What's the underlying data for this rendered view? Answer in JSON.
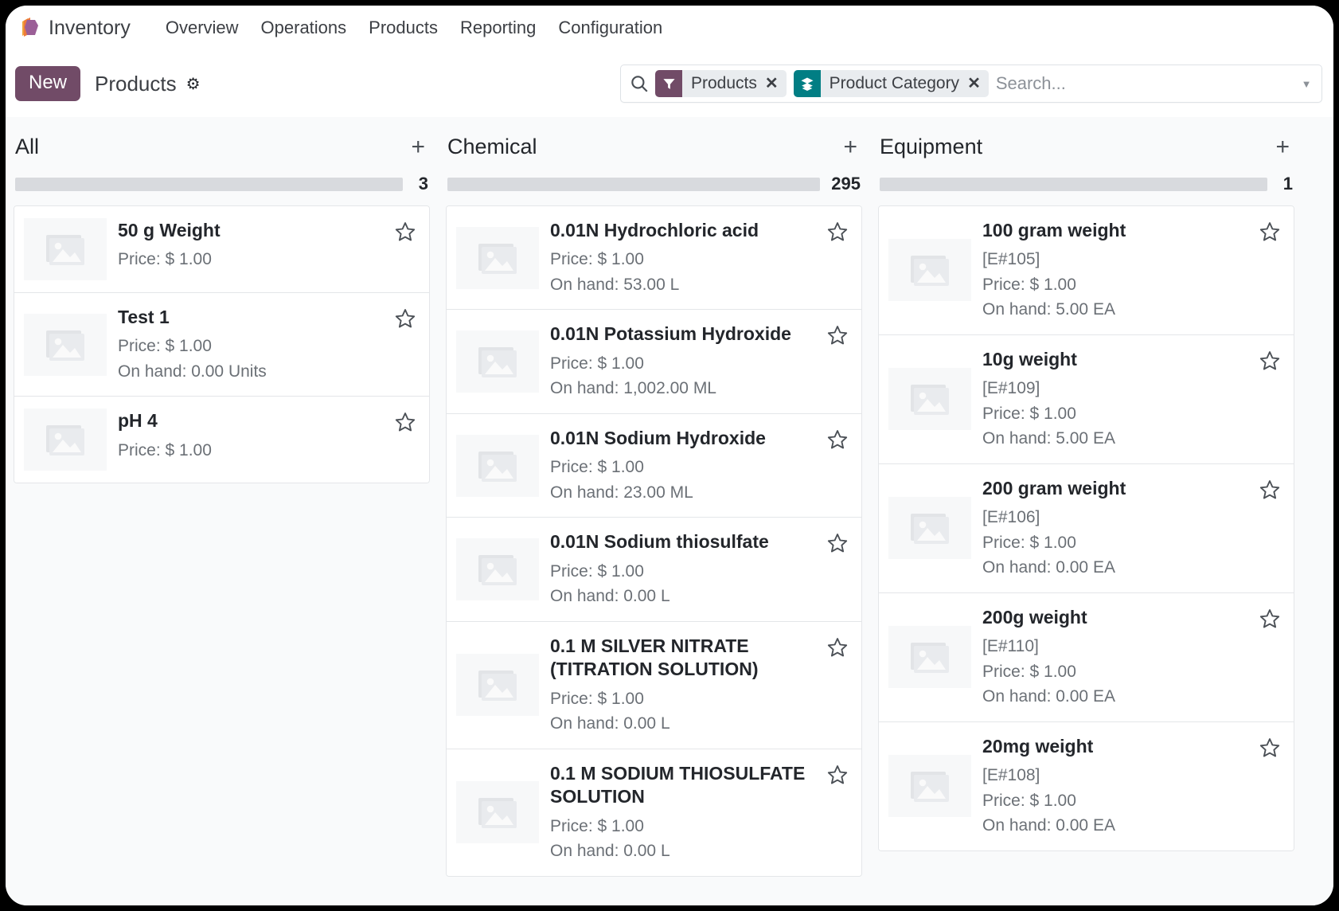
{
  "navbar": {
    "logo_icon": "inventory-box-icon",
    "app_name": "Inventory",
    "menu": [
      {
        "label": "Overview"
      },
      {
        "label": "Operations"
      },
      {
        "label": "Products"
      },
      {
        "label": "Reporting"
      },
      {
        "label": "Configuration"
      }
    ]
  },
  "control_panel": {
    "new_label": "New",
    "breadcrumb": "Products",
    "gear_icon": "gear-icon",
    "search": {
      "search_icon": "search-icon",
      "placeholder": "Search...",
      "value": "",
      "caret_icon": "chevron-down-icon",
      "facets": [
        {
          "label": "Products",
          "icon": "filter-icon",
          "color": "#714b67",
          "remove_icon": "close-icon"
        },
        {
          "label": "Product Category",
          "icon": "layers-icon",
          "color": "#017e84",
          "remove_icon": "close-icon"
        }
      ]
    }
  },
  "board": {
    "columns": [
      {
        "title": "All",
        "count": "3",
        "add_icon": "plus-icon",
        "cards": [
          {
            "title": "50 g Weight",
            "ref": "",
            "price": "Price: $ 1.00",
            "onhand": ""
          },
          {
            "title": "Test 1",
            "ref": "",
            "price": "Price: $ 1.00",
            "onhand": "On hand: 0.00 Units"
          },
          {
            "title": "pH 4",
            "ref": "",
            "price": "Price: $ 1.00",
            "onhand": ""
          }
        ]
      },
      {
        "title": "Chemical",
        "count": "295",
        "add_icon": "plus-icon",
        "cards": [
          {
            "title": "0.01N Hydrochloric acid",
            "ref": "",
            "price": "Price: $ 1.00",
            "onhand": "On hand: 53.00 L"
          },
          {
            "title": "0.01N Potassium Hydroxide",
            "ref": "",
            "price": "Price: $ 1.00",
            "onhand": "On hand: 1,002.00 ML"
          },
          {
            "title": "0.01N Sodium Hydroxide",
            "ref": "",
            "price": "Price: $ 1.00",
            "onhand": "On hand: 23.00 ML"
          },
          {
            "title": "0.01N Sodium thiosulfate",
            "ref": "",
            "price": "Price: $ 1.00",
            "onhand": "On hand: 0.00 L"
          },
          {
            "title": "0.1 M SILVER NITRATE (TITRATION SOLUTION)",
            "ref": "",
            "price": "Price: $ 1.00",
            "onhand": "On hand: 0.00 L"
          },
          {
            "title": "0.1 M SODIUM THIOSULFATE SOLUTION",
            "ref": "",
            "price": "Price: $ 1.00",
            "onhand": "On hand: 0.00 L"
          }
        ]
      },
      {
        "title": "Equipment",
        "count": "1",
        "add_icon": "plus-icon",
        "cards": [
          {
            "title": "100 gram weight",
            "ref": "[E#105]",
            "price": "Price: $ 1.00",
            "onhand": "On hand: 5.00 EA"
          },
          {
            "title": "10g weight",
            "ref": "[E#109]",
            "price": "Price: $ 1.00",
            "onhand": "On hand: 5.00 EA"
          },
          {
            "title": "200 gram weight",
            "ref": "[E#106]",
            "price": "Price: $ 1.00",
            "onhand": "On hand: 0.00 EA"
          },
          {
            "title": "200g weight",
            "ref": "[E#110]",
            "price": "Price: $ 1.00",
            "onhand": "On hand: 0.00 EA"
          },
          {
            "title": "20mg weight",
            "ref": "[E#108]",
            "price": "Price: $ 1.00",
            "onhand": "On hand: 0.00 EA"
          }
        ]
      }
    ]
  }
}
